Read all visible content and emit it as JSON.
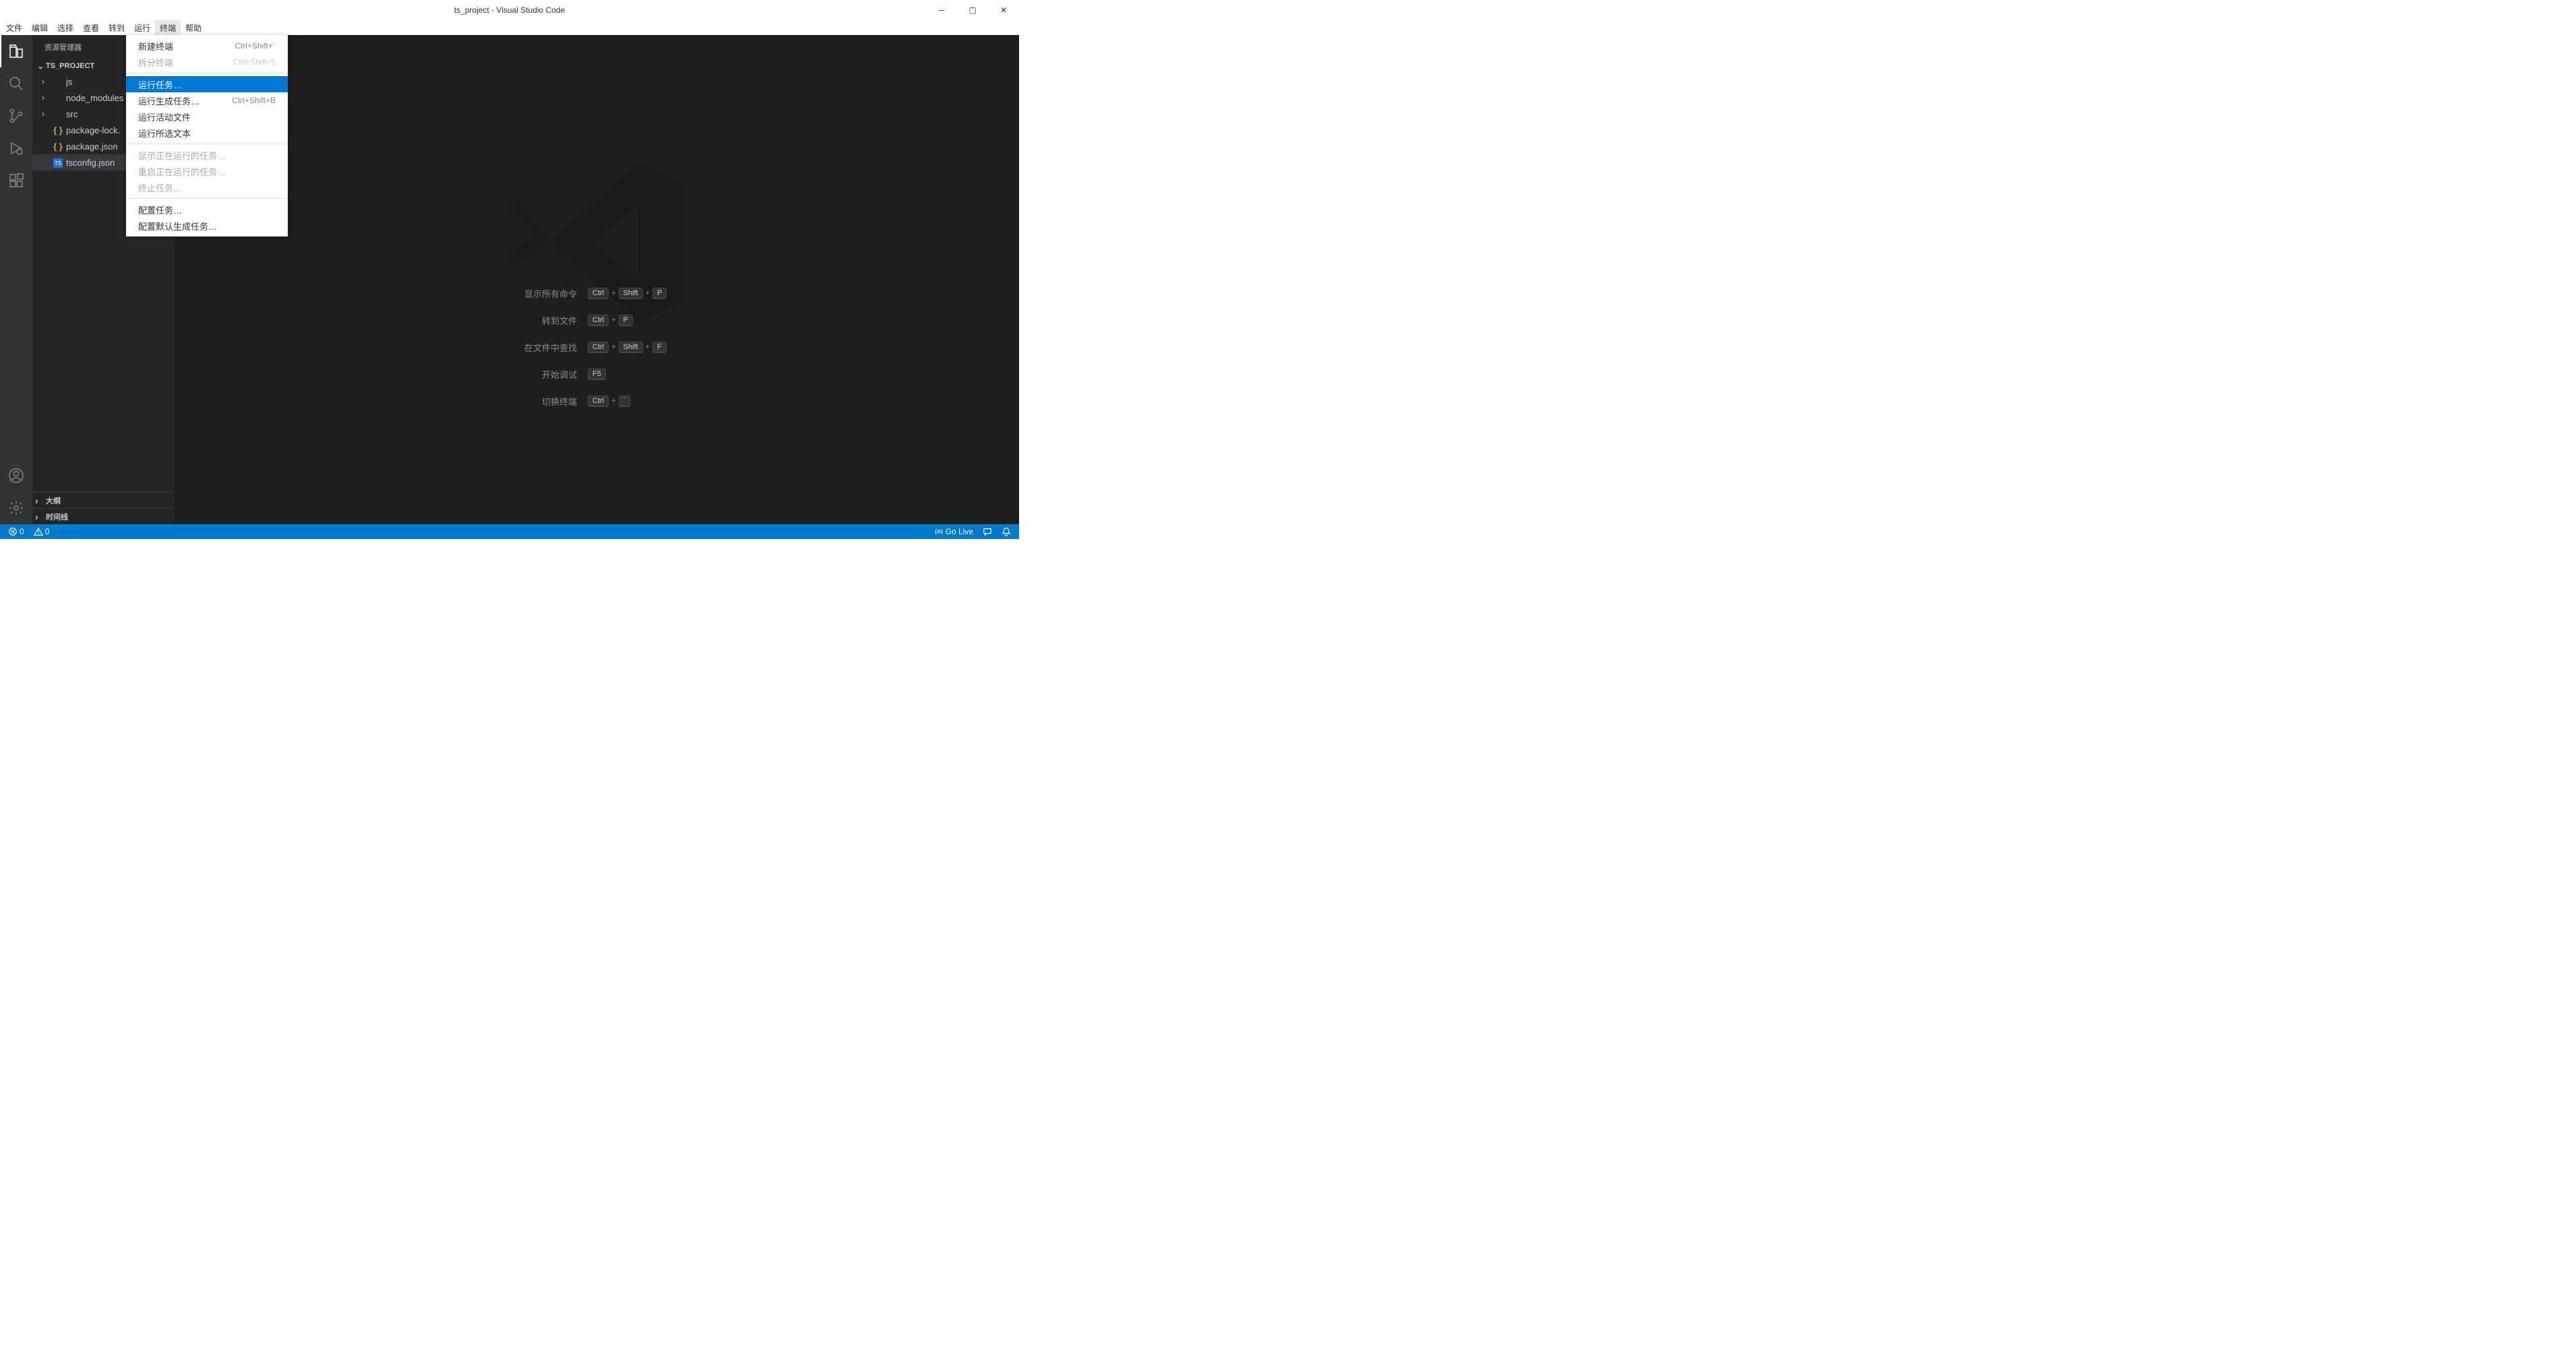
{
  "window": {
    "title": "ts_project - Visual Studio Code"
  },
  "menu": {
    "items": [
      "文件",
      "编辑",
      "选择",
      "查看",
      "转到",
      "运行",
      "终端",
      "帮助"
    ],
    "active_index": 6
  },
  "dropdown": {
    "groups": [
      [
        {
          "label": "新建终端",
          "shortcut": "Ctrl+Shift+`",
          "disabled": false
        },
        {
          "label": "拆分终端",
          "shortcut": "Ctrl+Shift+5",
          "disabled": true
        }
      ],
      [
        {
          "label": "运行任务…",
          "shortcut": "",
          "disabled": false,
          "highlighted": true
        },
        {
          "label": "运行生成任务…",
          "shortcut": "Ctrl+Shift+B",
          "disabled": false
        },
        {
          "label": "运行活动文件",
          "shortcut": "",
          "disabled": false
        },
        {
          "label": "运行所选文本",
          "shortcut": "",
          "disabled": false
        }
      ],
      [
        {
          "label": "显示正在运行的任务…",
          "shortcut": "",
          "disabled": true
        },
        {
          "label": "重启正在运行的任务…",
          "shortcut": "",
          "disabled": true
        },
        {
          "label": "终止任务…",
          "shortcut": "",
          "disabled": true
        }
      ],
      [
        {
          "label": "配置任务…",
          "shortcut": "",
          "disabled": false
        },
        {
          "label": "配置默认生成任务…",
          "shortcut": "",
          "disabled": false
        }
      ]
    ]
  },
  "sidebar": {
    "title": "资源管理器",
    "project": "TS_PROJECT",
    "tree": [
      {
        "label": "js",
        "icon": "chevron",
        "depth": 1
      },
      {
        "label": "node_modules",
        "icon": "chevron",
        "depth": 1
      },
      {
        "label": "src",
        "icon": "chevron",
        "depth": 1
      },
      {
        "label": "package-lock.json",
        "icon": "braces",
        "depth": 1,
        "truncated": "package-lock."
      },
      {
        "label": "package.json",
        "icon": "braces",
        "depth": 1
      },
      {
        "label": "tsconfig.json",
        "icon": "ts",
        "depth": 1,
        "selected": true
      }
    ],
    "panels": [
      "大纲",
      "时间线"
    ]
  },
  "welcome": {
    "shortcuts": [
      {
        "label": "显示所有命令",
        "keys": [
          "Ctrl",
          "+",
          "Shift",
          "+",
          "P"
        ]
      },
      {
        "label": "转到文件",
        "keys": [
          "Ctrl",
          "+",
          "P"
        ]
      },
      {
        "label": "在文件中查找",
        "keys": [
          "Ctrl",
          "+",
          "Shift",
          "+",
          "F"
        ]
      },
      {
        "label": "开始调试",
        "keys": [
          "F5"
        ]
      },
      {
        "label": "切换终端",
        "keys": [
          "Ctrl",
          "+",
          "`"
        ]
      }
    ]
  },
  "statusbar": {
    "errors": "0",
    "warnings": "0",
    "golive": "Go Live"
  }
}
